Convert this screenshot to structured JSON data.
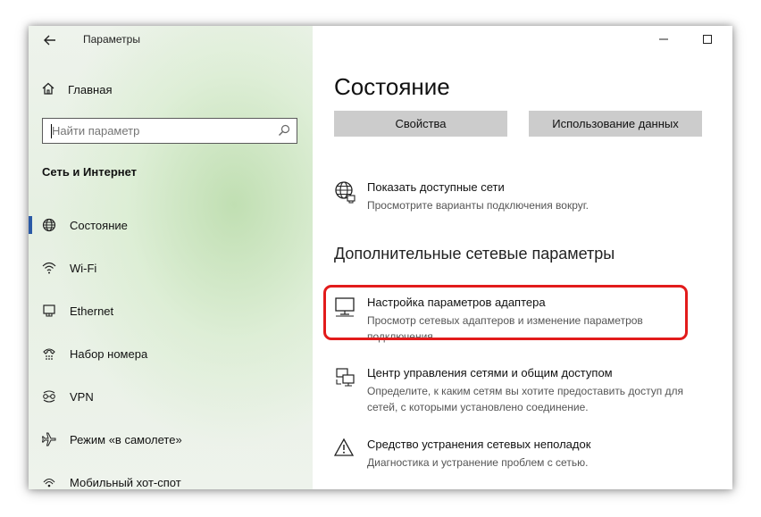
{
  "window": {
    "title": "Параметры",
    "back_icon": "back-arrow-icon",
    "controls": [
      "minimize-icon",
      "maximize-icon",
      "close-icon"
    ]
  },
  "sidebar": {
    "home_label": "Главная",
    "search_placeholder": "Найти параметр",
    "section_title": "Сеть и Интернет",
    "items": [
      {
        "label": "Состояние",
        "icon": "globe-icon",
        "active": true
      },
      {
        "label": "Wi-Fi",
        "icon": "wifi-icon"
      },
      {
        "label": "Ethernet",
        "icon": "ethernet-icon"
      },
      {
        "label": "Набор номера",
        "icon": "dialup-icon"
      },
      {
        "label": "VPN",
        "icon": "vpn-icon"
      },
      {
        "label": "Режим «в самолете»",
        "icon": "airplane-icon"
      },
      {
        "label": "Мобильный хот-спот",
        "icon": "hotspot-icon"
      }
    ]
  },
  "main": {
    "page_title": "Состояние",
    "buttons": {
      "properties": "Свойства",
      "data_usage": "Использование данных"
    },
    "show_networks": {
      "title": "Показать доступные сети",
      "desc": "Просмотрите варианты подключения вокруг."
    },
    "advanced_title": "Дополнительные сетевые параметры",
    "adapter": {
      "title": "Настройка параметров адаптера",
      "desc": "Просмотр сетевых адаптеров и изменение параметров подключения."
    },
    "sharing_center": {
      "title": "Центр управления сетями и общим доступом",
      "desc": "Определите, к каким сетям вы хотите предоставить доступ для сетей, с которыми установлено соединение."
    },
    "troubleshooter": {
      "title": "Средство устранения сетевых неполадок",
      "desc": "Диагностика и устранение проблем с сетью."
    }
  },
  "colors": {
    "highlight": "#e21b1b",
    "accent": "#2b5aa6",
    "button_bg": "#cccccc"
  }
}
